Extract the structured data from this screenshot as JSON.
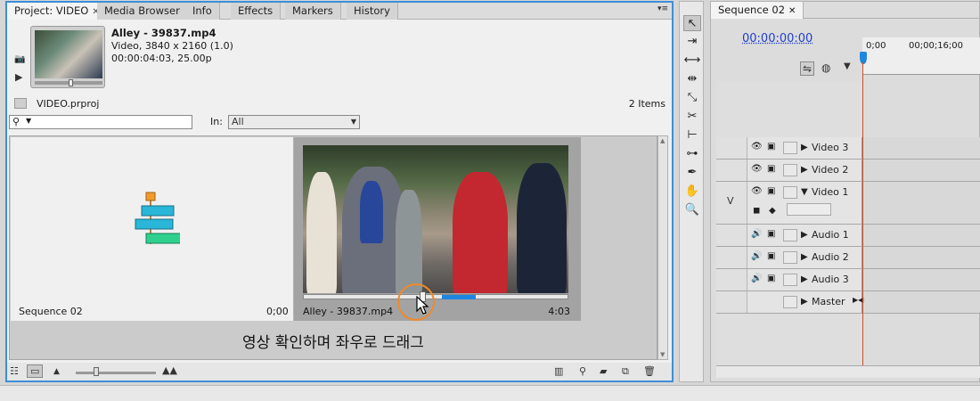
{
  "project_panel": {
    "tabs": [
      "Project: VIDEO",
      "Media Browser",
      "Info",
      "Effects",
      "Markers",
      "History"
    ],
    "close_glyph": "✕",
    "menu_glyph": "▾≡",
    "clip": {
      "name": "Alley - 39837.mp4",
      "info_line1": "Video, 3840 x 2160 (1.0)",
      "info_line2": "00:00:04:03, 25.00p"
    },
    "project_file": "VIDEO.prproj",
    "items_count": "2 Items",
    "search": {
      "value": "",
      "placeholder": ""
    },
    "in_label": "In:",
    "in_select_value": "All",
    "bin_items": [
      {
        "name": "Sequence 02",
        "duration": "0;00"
      },
      {
        "name": "Alley - 39837.mp4",
        "duration": "4:03",
        "scrub_position": 0.45
      }
    ],
    "caption": "영상 확인하며 좌우로 드래그"
  },
  "tools": [
    "selection-tool",
    "track-select-tool",
    "ripple-edit-tool",
    "rolling-edit-tool",
    "rate-stretch-tool",
    "razor-tool",
    "slip-tool",
    "slide-tool",
    "pen-tool",
    "hand-tool",
    "zoom-tool"
  ],
  "timeline": {
    "tab": "Sequence 02",
    "timecode": "00:00:00:00",
    "ruler_labels": [
      "0;00",
      "00;00;16;00"
    ],
    "tracks": [
      {
        "name": "Video 3",
        "type": "video"
      },
      {
        "name": "Video 2",
        "type": "video"
      },
      {
        "name": "Video 1",
        "type": "video",
        "expanded": true,
        "target": "V"
      },
      {
        "name": "Audio 1",
        "type": "audio"
      },
      {
        "name": "Audio 2",
        "type": "audio"
      },
      {
        "name": "Audio 3",
        "type": "audio"
      },
      {
        "name": "Master",
        "type": "master"
      }
    ]
  },
  "colors": {
    "accent_blue": "#3c8fd6",
    "timecode_blue": "#1f3fd0",
    "playhead_red": "#c8502a",
    "cursor_ring_orange": "#f08a2a"
  }
}
